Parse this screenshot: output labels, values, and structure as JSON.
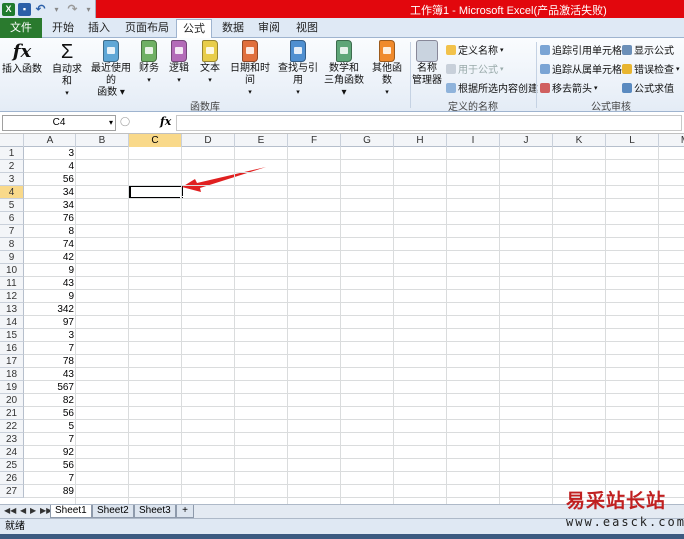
{
  "window": {
    "title": "工作簿1 - Microsoft Excel(产品激活失败)"
  },
  "tabs": [
    "文件",
    "开始",
    "插入",
    "页面布局",
    "公式",
    "数据",
    "审阅",
    "视图"
  ],
  "ribbon": {
    "insert_function": "插入函数",
    "autosum": "自动求和",
    "recent_line1": "最近使用的",
    "recent_line2": "函数",
    "financial": "财务",
    "logical": "逻辑",
    "text": "文本",
    "datetime": "日期和时间",
    "lookup": "查找与引用",
    "math_line1": "数学和",
    "math_line2": "三角函数",
    "other": "其他函数",
    "library_label": "函数库",
    "name_mgr_line1": "名称",
    "name_mgr_line2": "管理器",
    "define_name": "定义名称",
    "use_in_formula": "用于公式",
    "create_from_sel": "根据所选内容创建",
    "defined_names_label": "定义的名称",
    "trace_precedents": "追踪引用单元格",
    "trace_dependents": "追踪从属单元格",
    "remove_arrows": "移去箭头",
    "show_formulas": "显示公式",
    "error_checking": "错误检查",
    "evaluate_formula": "公式求值",
    "auditing_label": "公式审核"
  },
  "formula_bar": {
    "name_box": "C4",
    "fx": "fx",
    "value": ""
  },
  "columns": [
    "A",
    "B",
    "C",
    "D",
    "E",
    "F",
    "G",
    "H",
    "I",
    "J",
    "K",
    "L",
    "M"
  ],
  "rows": [
    {
      "n": "1",
      "a": "3"
    },
    {
      "n": "2",
      "a": "4"
    },
    {
      "n": "3",
      "a": "56"
    },
    {
      "n": "4",
      "a": "34"
    },
    {
      "n": "5",
      "a": "34"
    },
    {
      "n": "6",
      "a": "76"
    },
    {
      "n": "7",
      "a": "8"
    },
    {
      "n": "8",
      "a": "74"
    },
    {
      "n": "9",
      "a": "42"
    },
    {
      "n": "10",
      "a": "9"
    },
    {
      "n": "11",
      "a": "43"
    },
    {
      "n": "12",
      "a": "9"
    },
    {
      "n": "13",
      "a": "342"
    },
    {
      "n": "14",
      "a": "97"
    },
    {
      "n": "15",
      "a": "3"
    },
    {
      "n": "16",
      "a": "7"
    },
    {
      "n": "17",
      "a": "78"
    },
    {
      "n": "18",
      "a": "43"
    },
    {
      "n": "19",
      "a": "567"
    },
    {
      "n": "20",
      "a": "82"
    },
    {
      "n": "21",
      "a": "56"
    },
    {
      "n": "22",
      "a": "5"
    },
    {
      "n": "23",
      "a": "7"
    },
    {
      "n": "24",
      "a": "92"
    },
    {
      "n": "25",
      "a": "56"
    },
    {
      "n": "26",
      "a": "7"
    },
    {
      "n": "27",
      "a": "89"
    }
  ],
  "selected_cell": "C4",
  "sheets": [
    "Sheet1",
    "Sheet2",
    "Sheet3"
  ],
  "status": "就绪",
  "watermark": {
    "cn": "易采站长站",
    "url": "www.easck.com"
  },
  "colors": {
    "title_bar": "#e2070d",
    "file_tab": "#2a7a2e",
    "selection_header": "#f9d98a",
    "arrow": "#e02020"
  }
}
